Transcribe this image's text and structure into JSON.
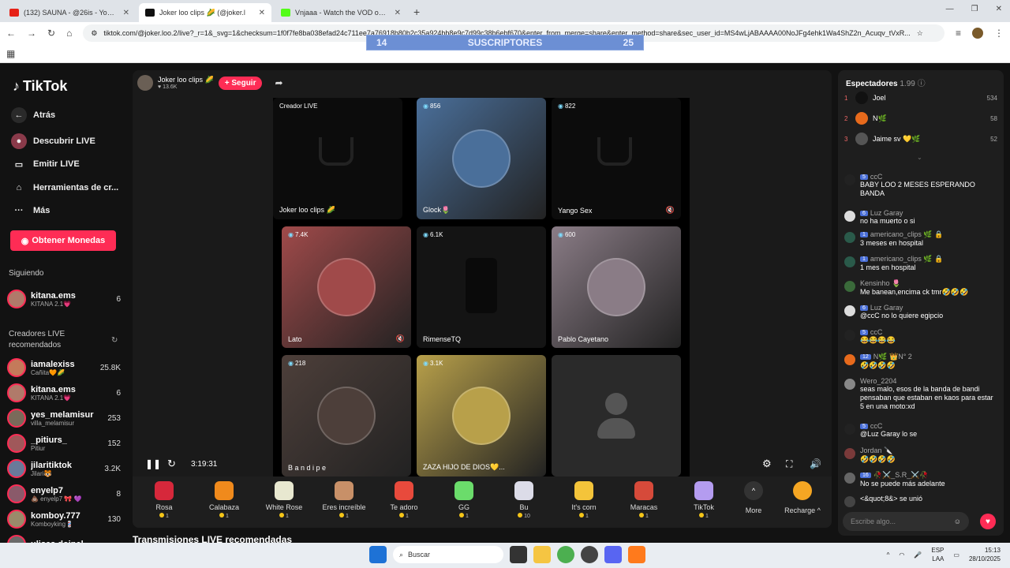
{
  "browser": {
    "tabs": [
      {
        "title": "(132) SAUNA - @26is - YouTube",
        "color": "#e62117"
      },
      {
        "title": "Joker loo clips 🌽 (@joker.l",
        "color": "#111111",
        "active": true
      },
      {
        "title": "Vnjaaa - Watch the VOD on Kic",
        "color": "#53fc18"
      }
    ],
    "url": "tiktok.com/@joker.loo.2/live?_r=1&_svg=1&checksum=1f0f7fe8ba038efad24c711ee7a76918b80b2c35a924bb8e9c7d99c38b6ebf670&enter_from_merge=share&enter_method=share&sec_user_id=MS4wLjABAAAA00NoJFg4ehk1Wa4ShZ2n_Acuqv_tVxR..."
  },
  "sub_banner": {
    "left": "14",
    "label": "SUSCRIPTORES",
    "right": "25"
  },
  "sidebar": {
    "logo": "TikTok",
    "nav": [
      {
        "label": "Atrás",
        "icon": "back-arrow-icon"
      },
      {
        "label": "Descubrir LIVE",
        "icon": "discover-live-icon"
      },
      {
        "label": "Emitir LIVE",
        "icon": "camera-icon"
      },
      {
        "label": "Herramientas de cr...",
        "icon": "house-icon"
      },
      {
        "label": "Más",
        "icon": "more-dots-icon"
      }
    ],
    "coins_button": "Obtener Monedas",
    "following_title": "Siguiendo",
    "following": [
      {
        "name": "kitana.ems",
        "sub": "KITANA 2.1💗",
        "count": "6"
      }
    ],
    "recommended_title": "Creadores LIVE recomendados",
    "recommended": [
      {
        "name": "iamalexiss",
        "sub": "Cañita🧡🌽",
        "count": "25.8K"
      },
      {
        "name": "kitana.ems",
        "sub": "KITANA 2.1💗",
        "count": "6"
      },
      {
        "name": "yes_melamisur",
        "sub": "villa_melamisur",
        "count": "253"
      },
      {
        "name": "_pitiurs_",
        "sub": "Pitiur",
        "count": "152"
      },
      {
        "name": "jilaritiktok",
        "sub": "Jilari🐯",
        "count": "3.2K"
      },
      {
        "name": "enyelp7",
        "sub": "💩 enyelp7 🎀 💜",
        "count": "8"
      },
      {
        "name": "komboy.777",
        "sub": "Komboyking💈",
        "count": "130"
      },
      {
        "name": "ulises.dojnel",
        "sub": "",
        "count": ""
      }
    ]
  },
  "stream": {
    "host_name": "Joker loo clips 🌽",
    "host_likes": "♥ 13.6K",
    "follow_label": "+ Seguir",
    "elapsed": "3:19:31",
    "cells": [
      {
        "label": "Joker loo clips 🌽",
        "count": "",
        "tag": "Creador LIVE",
        "kind": "cup"
      },
      {
        "label": "Glock🌷",
        "count": "856",
        "tag": "",
        "kind": "face",
        "color": "#4a6f9a"
      },
      {
        "label": "Yango Sex",
        "count": "822",
        "tag": "",
        "kind": "cup",
        "muted": true
      },
      {
        "label": "Lato",
        "count": "7.4K",
        "tag": "",
        "kind": "face",
        "color": "#a04a4a",
        "muted": true
      },
      {
        "label": "RimenseTQ",
        "count": "6.1K",
        "tag": "",
        "kind": "dark"
      },
      {
        "label": "Pablo Cayetano",
        "count": "600",
        "tag": "",
        "kind": "face",
        "color": "#8a7c86"
      },
      {
        "label": "B a n d i p e",
        "count": "218",
        "tag": "",
        "kind": "face",
        "color": "#4d3f3a"
      },
      {
        "label": "ZAZA HIJO DE DIOS💛...",
        "count": "3.1K",
        "tag": "",
        "kind": "face",
        "color": "#b8a04a"
      },
      {
        "label": "",
        "count": "",
        "tag": "",
        "kind": "empty"
      }
    ],
    "gifts": [
      {
        "name": "Rosa",
        "price": "1",
        "color": "#d6283b"
      },
      {
        "name": "Calabaza",
        "price": "1",
        "color": "#f08a1c"
      },
      {
        "name": "White Rose",
        "price": "1",
        "color": "#e8e8d0"
      },
      {
        "name": "Eres increíble",
        "price": "1",
        "color": "#c89068"
      },
      {
        "name": "Te adoro",
        "price": "1",
        "color": "#e84a3c"
      },
      {
        "name": "GG",
        "price": "1",
        "color": "#6bdc6b"
      },
      {
        "name": "Bu",
        "price": "10",
        "color": "#dcdce8"
      },
      {
        "name": "It's corn",
        "price": "1",
        "color": "#f4c43a"
      },
      {
        "name": "Maracas",
        "price": "1",
        "color": "#d64a3a"
      },
      {
        "name": "TikTok",
        "price": "1",
        "color": "#b49cf0"
      }
    ],
    "more_label": "More",
    "recharge_label": "Recharge ^"
  },
  "chat": {
    "title": "Espectadores",
    "viewers_count": "1.99",
    "top_viewers": [
      {
        "rank": "1",
        "name": "Joel",
        "count": "534",
        "color": "#111111"
      },
      {
        "rank": "2",
        "name": "N🌿",
        "count": "58",
        "color": "#e76a1c"
      },
      {
        "rank": "3",
        "name": "Jaime sv 💛🌿",
        "count": "52",
        "color": "#555555"
      }
    ],
    "messages": [
      {
        "user": "ccC",
        "badge": "5",
        "text": "BABY LOO 2 MESES ESPERANDO BANDA",
        "color": "#222222"
      },
      {
        "user": "Luz Garay",
        "badge": "6",
        "text": "no ha muerto o si",
        "color": "#dddddd"
      },
      {
        "user": "americano_clips 🌿 🔒",
        "badge": "1",
        "text": "3 meses en hospital",
        "color": "#2a5a4a"
      },
      {
        "user": "americano_clips 🌿 🔒",
        "badge": "1",
        "text": "1 mes en hospital",
        "color": "#2a5a4a"
      },
      {
        "user": "Kensinho 🌷",
        "badge": "",
        "text": "Me banean,encima ck tmr🤣🤣🤣",
        "color": "#3a6a3a"
      },
      {
        "user": "Luz Garay",
        "badge": "6",
        "text": "@ccC no lo quiere egipcio",
        "color": "#dddddd"
      },
      {
        "user": "ccC",
        "badge": "5",
        "text": "😂😂😂😂",
        "color": "#222222"
      },
      {
        "user": "N🌿  👑N° 2",
        "badge": "12",
        "text": "🤣🤣🤣🤣",
        "color": "#e76a1c"
      },
      {
        "user": "Wero_2204",
        "badge": "",
        "text": "seas malo, esos de la banda de bandi pensaban que estaban en kaos para estar 5 en una moto:xd",
        "color": "#888888"
      },
      {
        "user": "ccC",
        "badge": "5",
        "text": "@Luz Garay lo se",
        "color": "#222222"
      },
      {
        "user": "Jordan 🔪",
        "badge": "",
        "text": "🤣🤣🤣🤣",
        "color": "#7a3a3a"
      },
      {
        "user": "🥀⚔️_S.R_⚔️🥀",
        "badge": "16",
        "text": "No se puede más adelante",
        "color": "#666666"
      },
      {
        "user": "",
        "badge": "",
        "text": "<&quot;8&> se unió",
        "color": "#444444"
      }
    ],
    "input_placeholder": "Escribe algo..."
  },
  "recommended_title": "Transmisiones LIVE recomendadas",
  "taskbar": {
    "search": "Buscar",
    "lang": "ESP",
    "lang2": "LAA",
    "time": "15:13",
    "date": "28/10/2025"
  }
}
